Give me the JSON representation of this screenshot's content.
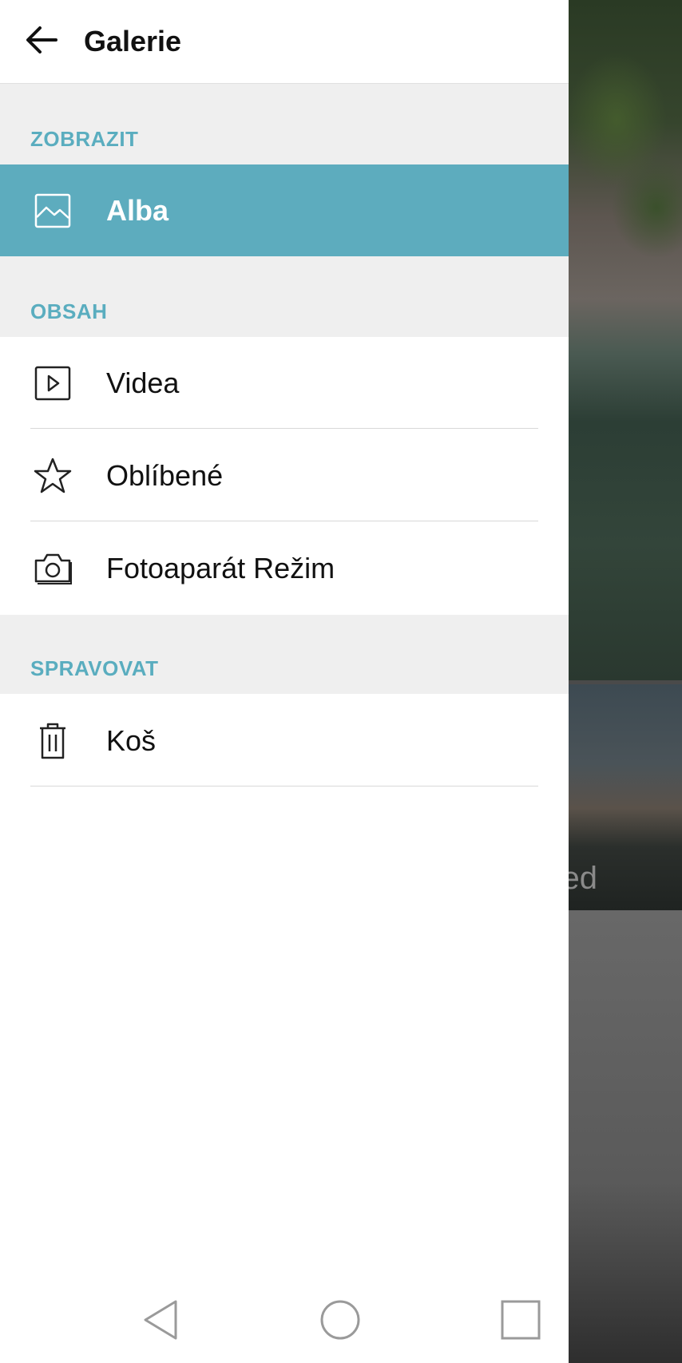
{
  "header": {
    "title": "Galerie",
    "back_icon": "arrow-left-icon"
  },
  "sections": {
    "view": {
      "label": "ZOBRAZIT",
      "items": [
        {
          "label": "Alba",
          "icon": "image-icon",
          "active": true
        }
      ]
    },
    "content": {
      "label": "OBSAH",
      "items": [
        {
          "label": "Videa",
          "icon": "video-play-icon"
        },
        {
          "label": "Oblíbené",
          "icon": "star-icon"
        },
        {
          "label": "Fotoaparát Režim",
          "icon": "camera-icon"
        }
      ]
    },
    "manage": {
      "label": "SPRAVOVAT",
      "items": [
        {
          "label": "Koš",
          "icon": "trash-icon"
        }
      ]
    }
  },
  "background": {
    "partial_text": "ed"
  },
  "navbar": {
    "back": "nav-back-icon",
    "home": "nav-home-icon",
    "recents": "nav-recents-icon"
  },
  "colors": {
    "accent": "#5dacbe",
    "section_label": "#5aadbf",
    "section_bg": "#efefef"
  }
}
